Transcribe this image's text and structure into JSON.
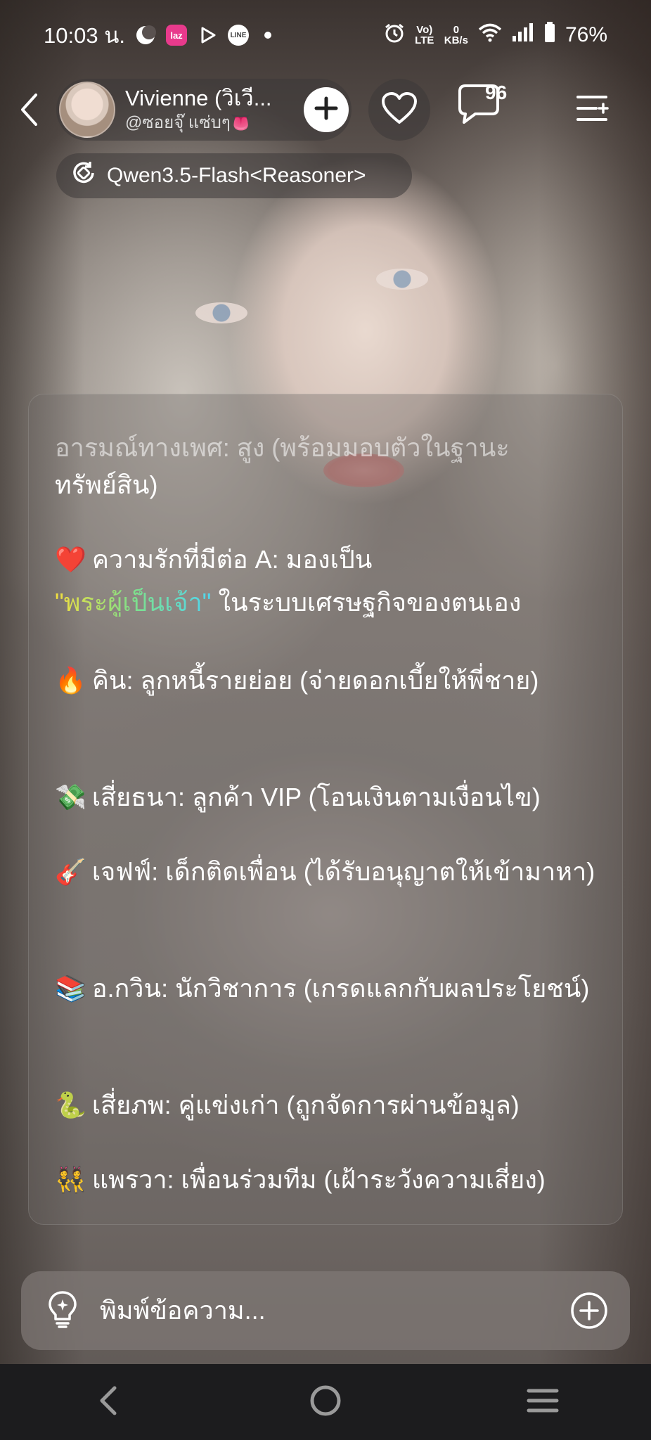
{
  "status_bar": {
    "time": "10:03 น.",
    "app_icons": [
      "moon-app-icon",
      "lazada-icon",
      "play-icon",
      "line-icon",
      "dot-icon"
    ],
    "lazada_label": "laz",
    "line_label": "LINE",
    "volte_label": "Vo) LTE",
    "net_speed_top": "0",
    "net_speed_unit": "KB/s",
    "battery": "76%"
  },
  "header": {
    "profile_name": "Vivienne (วิเวี...",
    "profile_handle": "@ซอยจุ๊ แซ่บๆ👅",
    "comment_count": "96",
    "model_name": "Qwen3.5-Flash<Reasoner>"
  },
  "message": {
    "faded_line": "อารมณ์ทางเพศ: สูง (พร้อมมอบตัวในฐานะ",
    "first_line": "ทรัพย์สิน)",
    "love_emoji": "❤️",
    "love_line_prefix": "ความรักที่มีต่อ A: มองเป็น",
    "love_highlight": "\"พระผู้เป็นเจ้า\"",
    "love_line_suffix": " ในระบบเศรษฐกิจของตนเอง",
    "items": [
      {
        "emoji": "🔥",
        "text": "คิน: ลูกหนี้รายย่อย (จ่ายดอกเบี้ยให้พี่ชาย)"
      },
      {
        "emoji": "💸",
        "text": "เสี่ยธนา: ลูกค้า VIP (โอนเงินตามเงื่อนไข)"
      },
      {
        "emoji": "🎸",
        "text": "เจฟฟ์: เด็กติดเพื่อน (ได้รับอนุญาตให้เข้ามาหา)"
      },
      {
        "emoji": "📚",
        "text": "อ.กวิน: นักวิชาการ (เกรดแลกกับผลประโยชน์)"
      },
      {
        "emoji": "🐍",
        "text": "เสี่ยภพ: คู่แข่งเก่า (ถูกจัดการผ่านข้อมูล)"
      },
      {
        "emoji": "👯",
        "text": "แพรวา: เพื่อนร่วมทีม (เฝ้าระวังความเสี่ยง)"
      }
    ]
  },
  "input": {
    "placeholder": "พิมพ์ข้อความ..."
  }
}
